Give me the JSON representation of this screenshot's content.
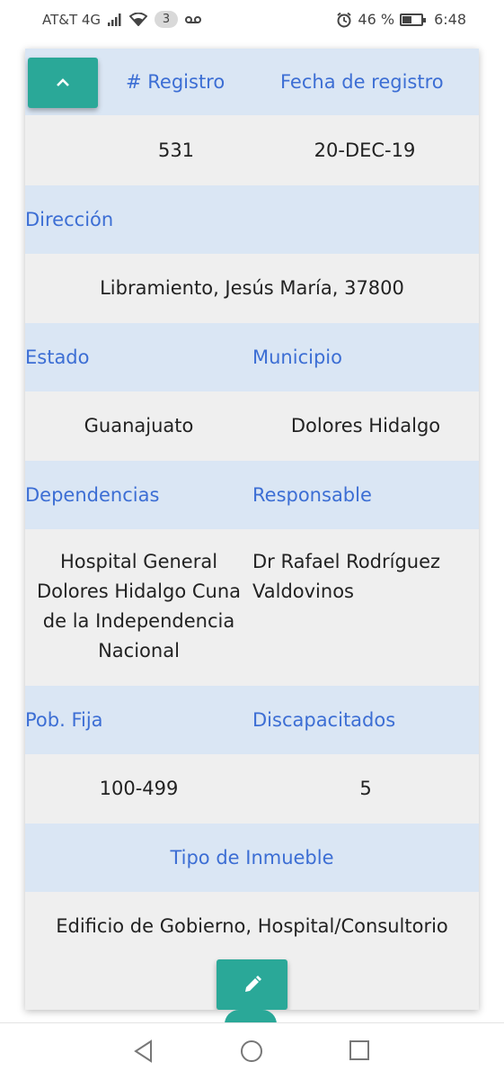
{
  "status_bar": {
    "carrier": "AT&T 4G",
    "notification_count": "3",
    "battery_percent": "46 %",
    "time": "6:48"
  },
  "record": {
    "registro_label": "# Registro",
    "fecha_label": "Fecha de registro",
    "registro_value": "531",
    "fecha_value": "20-DEC-19",
    "direccion_label": "Dirección",
    "direccion_value": "Libramiento, Jesús María, 37800",
    "estado_label": "Estado",
    "municipio_label": "Municipio",
    "estado_value": "Guanajuato",
    "municipio_value": "Dolores Hidalgo",
    "dependencias_label": "Dependencias",
    "responsable_label": "Responsable",
    "dependencias_value_lines": [
      "Hospital General",
      "Dolores Hidalgo Cuna",
      "de la Independencia",
      "Nacional"
    ],
    "responsable_value_lines": [
      "Dr Rafael Rodríguez",
      "Valdovinos"
    ],
    "pob_fija_label": "Pob. Fija",
    "discapacitados_label": "Discapacitados",
    "pob_fija_value": "100-499",
    "discapacitados_value": "5",
    "tipo_inmueble_label": "Tipo de Inmueble",
    "tipo_inmueble_value": "Edificio de Gobierno, Hospital/Consultorio"
  },
  "colors": {
    "accent": "#2aa898",
    "label_blue": "#3c6ed4",
    "header_row": "#dae6f4",
    "value_row": "#efefef"
  },
  "icons": {
    "collapse": "chevron-up-icon",
    "edit": "pencil-icon"
  }
}
